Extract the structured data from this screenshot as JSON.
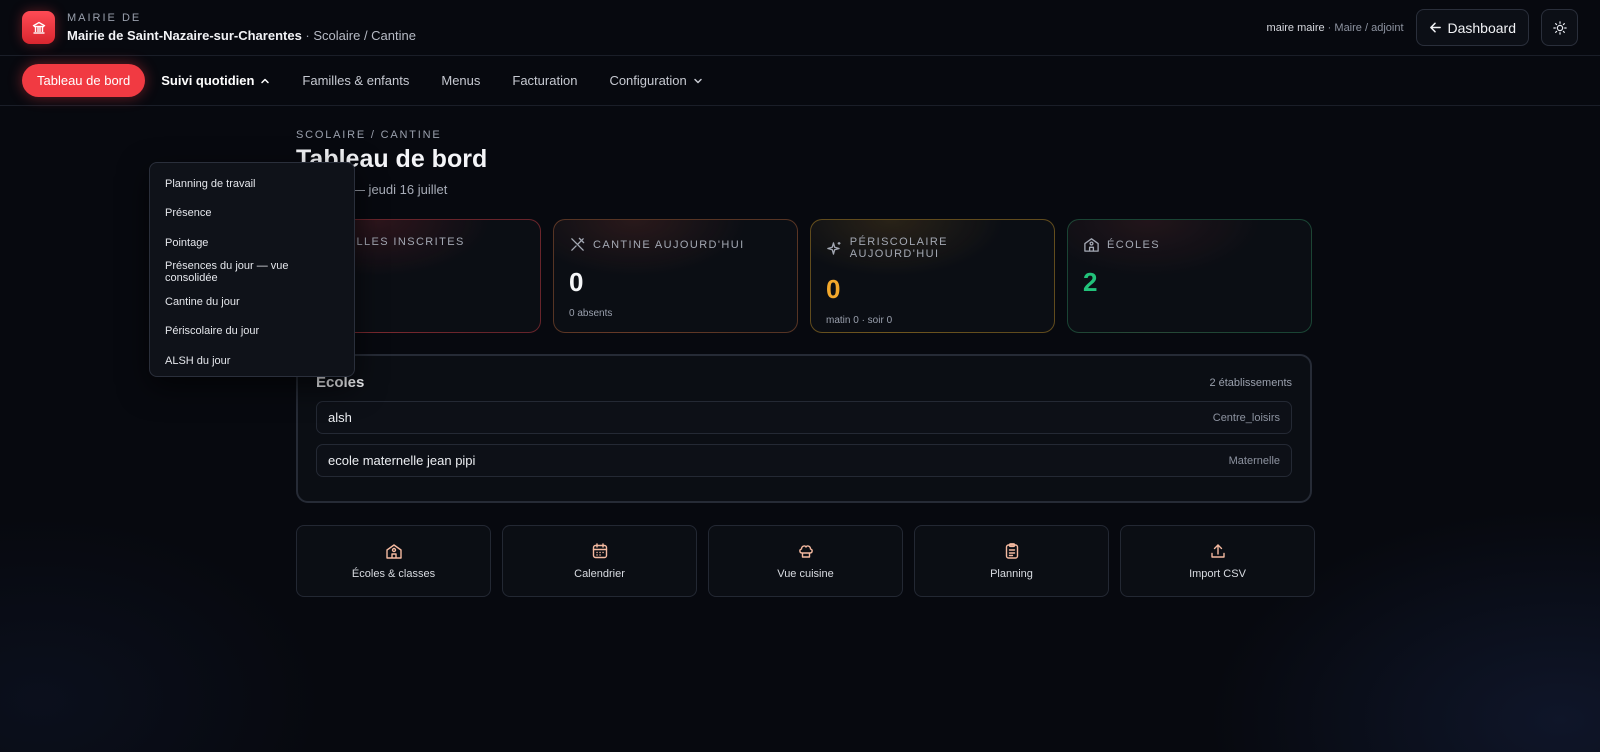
{
  "header": {
    "kicker": "MAIRIE DE",
    "name": "Mairie de Saint-Nazaire-sur-Charentes",
    "separator": " · ",
    "section": "Scolaire / Cantine",
    "user_name": "maire maire",
    "user_sep": " · ",
    "user_role": "Maire / adjoint",
    "dashboard_label": "Dashboard"
  },
  "nav": {
    "items": [
      {
        "label": "Tableau de bord"
      },
      {
        "label": "Suivi quotidien"
      },
      {
        "label": "Familles & enfants"
      },
      {
        "label": "Menus"
      },
      {
        "label": "Facturation"
      },
      {
        "label": "Configuration"
      }
    ]
  },
  "dropdown": {
    "items": [
      {
        "label": "Planning de travail"
      },
      {
        "label": "Présence"
      },
      {
        "label": "Pointage"
      },
      {
        "label": "Présences du jour — vue consolidée"
      },
      {
        "label": "Cantine du jour"
      },
      {
        "label": "Périscolaire du jour"
      },
      {
        "label": "ALSH du jour"
      }
    ]
  },
  "page": {
    "kicker": "SCOLAIRE / CANTINE",
    "title": "Tableau de bord",
    "subtitle_visible": "r — jeudi 16 juillet"
  },
  "stats": [
    {
      "label": "ILLES INSCRITES",
      "value": "",
      "sub": "",
      "icon": "users-icon"
    },
    {
      "label": "CANTINE AUJOURD'HUI",
      "value": "0",
      "sub": "0 absents",
      "icon": "utensils-icon"
    },
    {
      "label": "PÉRISCOLAIRE AUJOURD'HUI",
      "value": "0",
      "sub": "matin 0 · soir 0",
      "icon": "sparkles-icon"
    },
    {
      "label": "ÉCOLES",
      "value": "2",
      "sub": "",
      "icon": "school-icon"
    }
  ],
  "schools": {
    "title": "Écoles",
    "count": "2 établissements",
    "rows": [
      {
        "name": "alsh",
        "type": "Centre_loisirs"
      },
      {
        "name": "ecole maternelle jean pipi",
        "type": "Maternelle"
      }
    ]
  },
  "shortcuts": [
    {
      "label": "Écoles & classes",
      "icon": "school-icon"
    },
    {
      "label": "Calendrier",
      "icon": "calendar-icon"
    },
    {
      "label": "Vue cuisine",
      "icon": "chef-hat-icon"
    },
    {
      "label": "Planning",
      "icon": "clipboard-icon"
    },
    {
      "label": "Import CSV",
      "icon": "upload-icon"
    }
  ],
  "colors": {
    "accent": "#f13a42",
    "warning": "#f2a82c",
    "success": "#22c27a",
    "background": "#07090f"
  }
}
